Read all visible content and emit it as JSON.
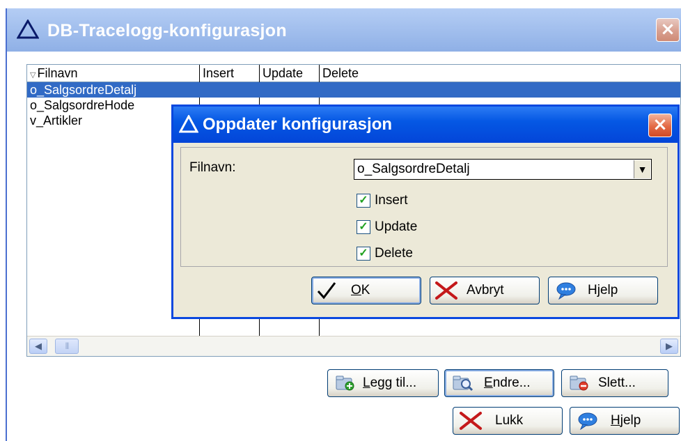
{
  "main": {
    "title": "DB-Tracelogg-konfigurasjon",
    "close_glyph": "×",
    "columns": [
      "Filnavn",
      "Insert",
      "Update",
      "Delete"
    ],
    "sort_glyph": "▽",
    "rows": [
      "o_SalgsordreDetalj",
      "o_SalgsordreHode",
      "v_Artikler"
    ],
    "buttons": {
      "add": {
        "pre": "",
        "key": "L",
        "post": "egg til..."
      },
      "edit": {
        "pre": "",
        "key": "E",
        "post": "ndre..."
      },
      "delete": {
        "pre": "Slett...",
        "key": "",
        "post": ""
      },
      "close": {
        "label": "Lukk"
      },
      "help": {
        "pre": "",
        "key": "H",
        "post": "jelp"
      }
    }
  },
  "dialog": {
    "title": "Oppdater konfigurasjon",
    "close_glyph": "×",
    "filename_label": "Filnavn:",
    "filename_value": "o_SalgsordreDetalj",
    "checkboxes": [
      {
        "label": "Insert",
        "checked": true
      },
      {
        "label": "Update",
        "checked": true
      },
      {
        "label": "Delete",
        "checked": true
      }
    ],
    "check_glyph": "✓",
    "buttons": {
      "ok": {
        "key": "O",
        "post": "K"
      },
      "cancel": {
        "label": "Avbryt"
      },
      "help": {
        "label": "Hjelp"
      }
    }
  },
  "colors": {
    "dialog_title_blue": "#0558e4",
    "main_title_blue": "#8fb0e6",
    "selection": "#316ac5",
    "dialog_bg": "#ece9d8"
  }
}
